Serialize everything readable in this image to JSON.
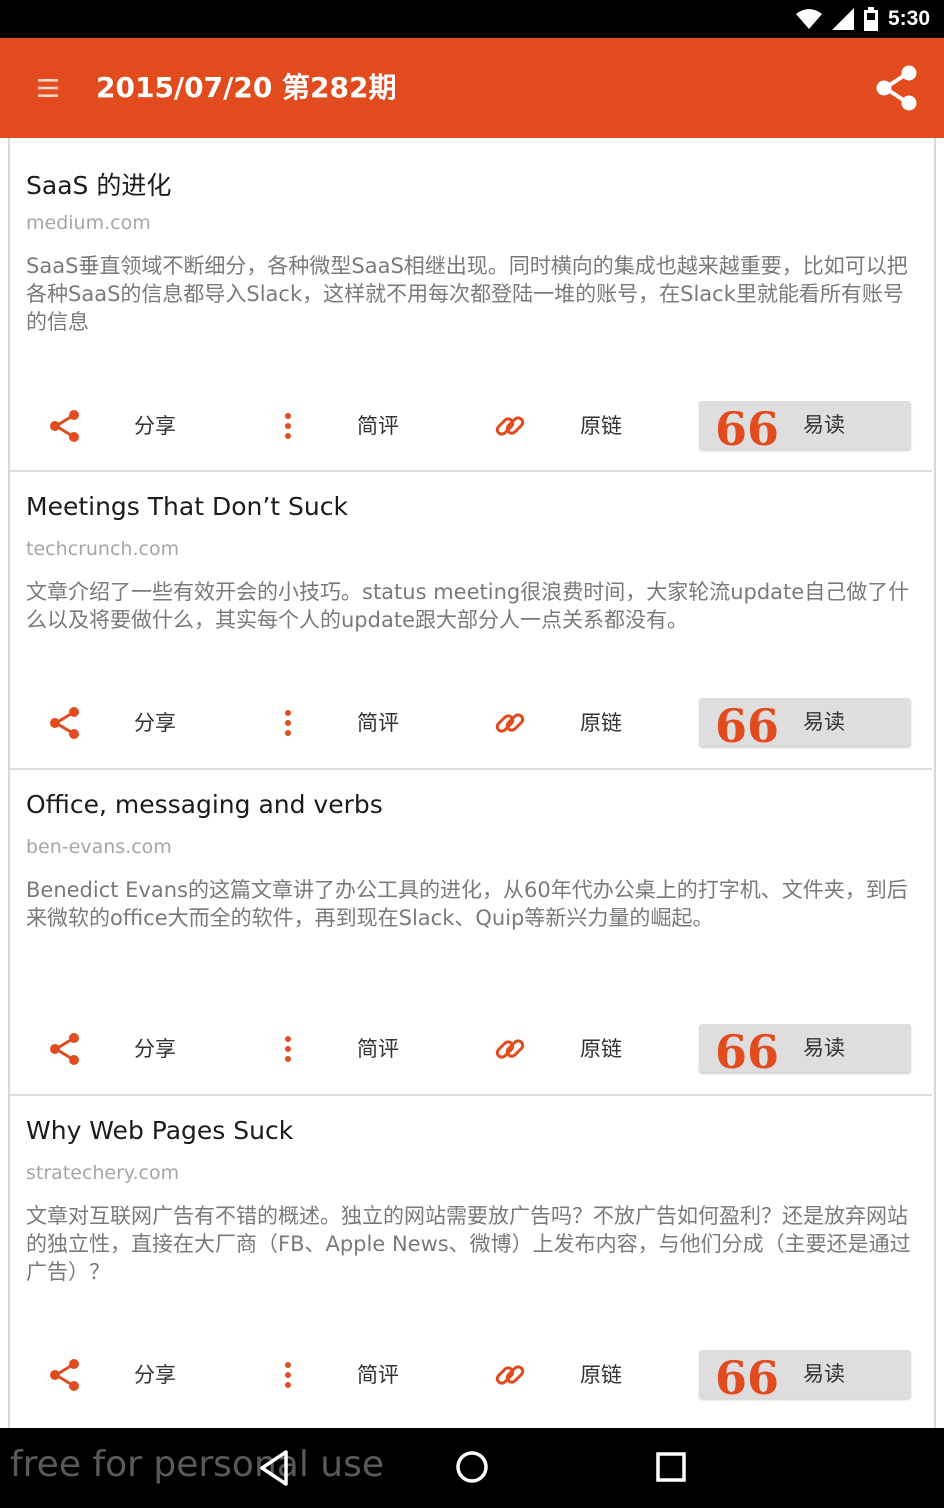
{
  "status_bar": {
    "time": "5:30"
  },
  "header": {
    "title": "2015/07/20 第282期"
  },
  "actions": {
    "share_label": "分享",
    "comment_label": "简评",
    "link_label": "原链",
    "read_label": "易读",
    "read_quote": "66"
  },
  "articles": [
    {
      "title": "SaaS 的进化",
      "domain": "medium.com",
      "summary": "SaaS垂直领域不断细分，各种微型SaaS相继出现。同时横向的集成也越来越重要，比如可以把各种SaaS的信息都导入Slack，这样就不用每次都登陆一堆的账号，在Slack里就能看所有账号的信息"
    },
    {
      "title": "Meetings That Don’t Suck",
      "domain": "techcrunch.com",
      "summary": "文章介绍了一些有效开会的小技巧。status meeting很浪费时间，大家轮流update自己做了什么以及将要做什么，其实每个人的update跟大部分人一点关系都没有。"
    },
    {
      "title": "Office, messaging and verbs",
      "domain": "ben-evans.com",
      "summary": "Benedict Evans的这篇文章讲了办公工具的进化，从60年代办公桌上的打字机、文件夹，到后来微软的office大而全的软件，再到现在Slack、Quip等新兴力量的崛起。"
    },
    {
      "title": "Why Web Pages Suck",
      "domain": "stratechery.com",
      "summary": "文章对互联网广告有不错的概述。独立的网站需要放广告吗？不放广告如何盈利？还是放弃网站的独立性，直接在大厂商（FB、Apple News、微博）上发布内容，与他们分成（主要还是通过广告）？"
    }
  ],
  "watermark": "free for personal use",
  "colors": {
    "accent": "#e14b1e",
    "read_button_bg": "#dedede"
  }
}
